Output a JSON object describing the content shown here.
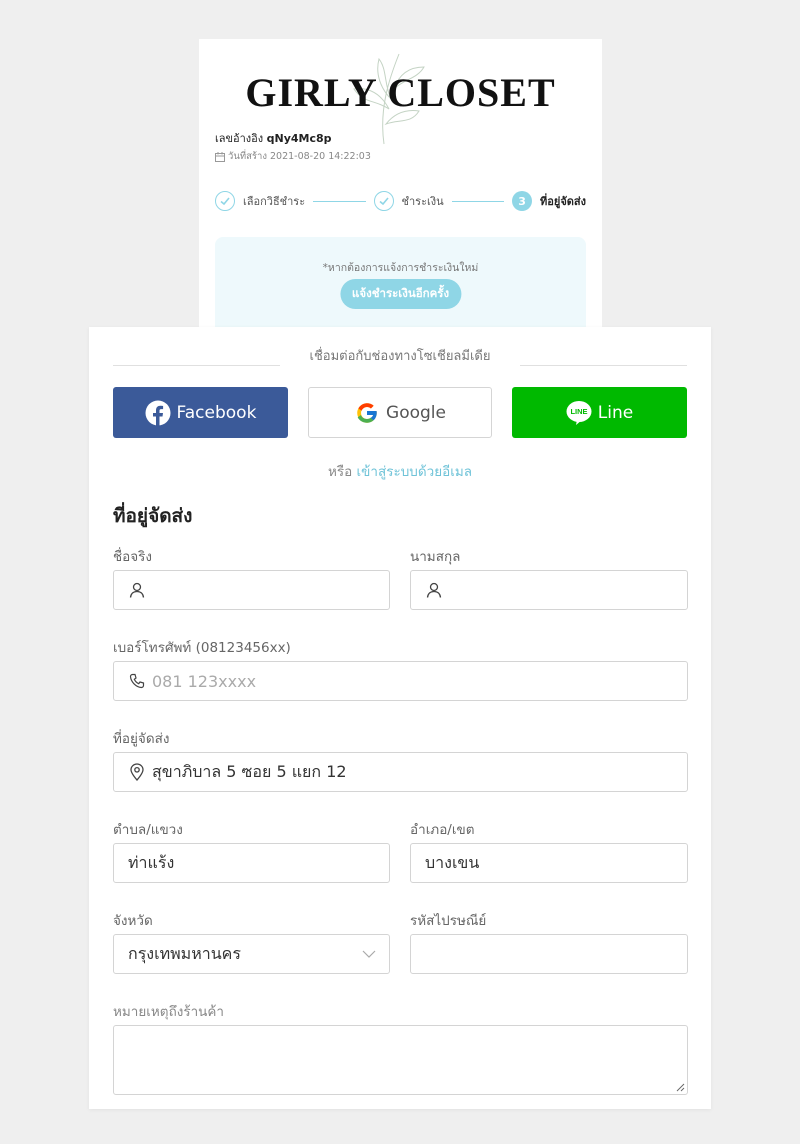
{
  "brand": {
    "name": "GIRLY CLOSET"
  },
  "order": {
    "ref_label": "เลขอ้างอิง",
    "ref_value": "qNy4Mc8p",
    "created_label": "วันที่สร้าง 2021-08-20 14:22:03"
  },
  "steps": [
    {
      "label": "เลือกวิธีชำระ",
      "state": "done"
    },
    {
      "label": "ชำระเงิน",
      "state": "done"
    },
    {
      "number": "3",
      "label": "ที่อยู่จัดส่ง",
      "state": "active"
    }
  ],
  "notice": {
    "text": "*หากต้องการแจ้งการชำระเงินใหม่",
    "button_label": "แจ้งชำระเงินอีกครั้ง"
  },
  "social": {
    "heading": "เชื่อมต่อกับช่องทางโซเชียลมีเดีย",
    "facebook_label": "Facebook",
    "google_label": "Google",
    "line_label": "Line",
    "line_logo_text": "LINE",
    "or_text": "หรือ",
    "email_link": "เข้าสู่ระบบด้วยอีเมล"
  },
  "form": {
    "title": "ที่อยู่จัดส่ง",
    "first_name_label": "ชื่อจริง",
    "first_name_value": "",
    "last_name_label": "นามสกุล",
    "last_name_value": "",
    "phone_label": "เบอร์โทรศัพท์ (08123456xx)",
    "phone_placeholder": "081 123xxxx",
    "address_label": "ที่อยู่จัดส่ง",
    "address_value": "สุขาภิบาล 5 ซอย 5 แยก 12",
    "subdistrict_label": "ตำบล/แขวง",
    "subdistrict_value": "ท่าแร้ง",
    "district_label": "อำเภอ/เขต",
    "district_value": "บางเขน",
    "province_label": "จังหวัด",
    "province_value": "กรุงเทพมหานคร",
    "postcode_label": "รหัสไปรษณีย์",
    "postcode_value": "",
    "note_label": "หมายเหตุถึงร้านค้า",
    "note_value": ""
  },
  "colors": {
    "accent": "#8fd6e6",
    "facebook": "#3b5a99",
    "line": "#00b900",
    "background": "#efefef"
  }
}
